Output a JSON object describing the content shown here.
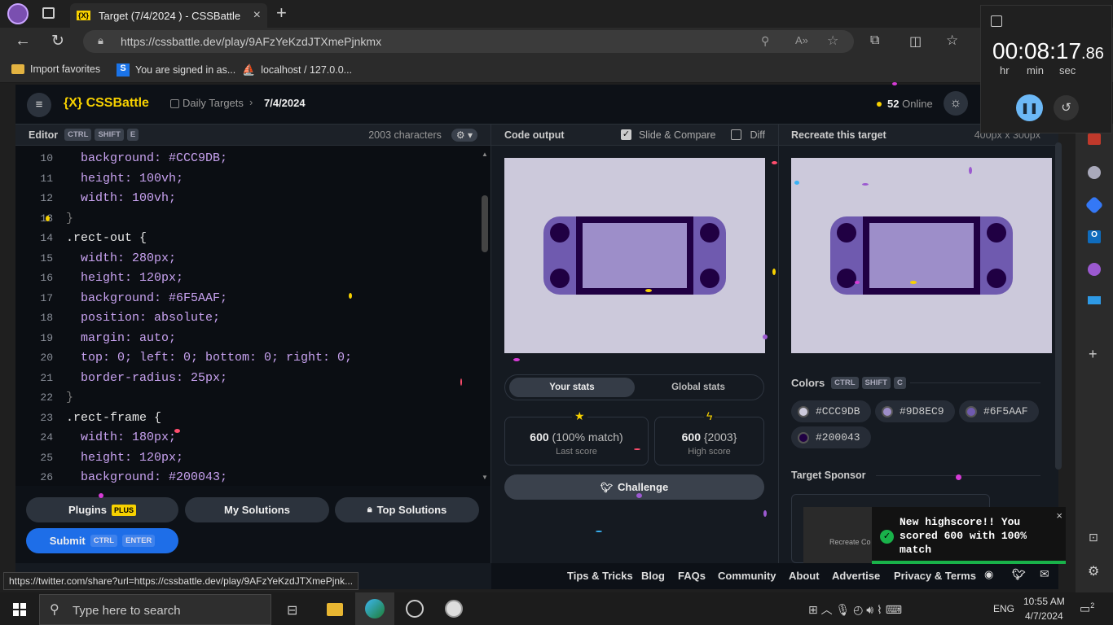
{
  "browser": {
    "tab_title": "Target (7/4/2024 ) - CSSBattle",
    "url": "https://cssbattle.dev/play/9AFzYeKzdJTXmePjnkmx",
    "favorites": [
      "Import favorites",
      "You are signed in as...",
      "localhost / 127.0.0..."
    ]
  },
  "timer": {
    "hours": "00",
    "minutes": "08",
    "seconds": "17",
    "fraction": ".86",
    "labels": [
      "hr",
      "min",
      "sec"
    ]
  },
  "site": {
    "logo": "{X} CSSBattle",
    "breadcrumb_section": "Daily Targets",
    "breadcrumb_date": "7/4/2024",
    "online_count": "52",
    "online_label": "Online"
  },
  "editor": {
    "label": "Editor",
    "keys": [
      "CTRL",
      "SHIFT",
      "E"
    ],
    "chars": "2003 characters",
    "lines": [
      {
        "n": "10",
        "t": "  background: #CCC9DB;"
      },
      {
        "n": "11",
        "t": "  height: 100vh;"
      },
      {
        "n": "12",
        "t": "  width: 100vh;"
      },
      {
        "n": "13",
        "t": "}"
      },
      {
        "n": "14",
        "t": ".rect-out {"
      },
      {
        "n": "15",
        "t": "  width: 280px;"
      },
      {
        "n": "16",
        "t": "  height: 120px;"
      },
      {
        "n": "17",
        "t": "  background: #6F5AAF;"
      },
      {
        "n": "18",
        "t": "  position: absolute;"
      },
      {
        "n": "19",
        "t": "  margin: auto;"
      },
      {
        "n": "20",
        "t": "  top: 0; left: 0; bottom: 0; right: 0;"
      },
      {
        "n": "21",
        "t": "  border-radius: 25px;"
      },
      {
        "n": "22",
        "t": "}"
      },
      {
        "n": "23",
        "t": ".rect-frame {"
      },
      {
        "n": "24",
        "t": "  width: 180px;"
      },
      {
        "n": "25",
        "t": "  height: 120px;"
      },
      {
        "n": "26",
        "t": "  background: #200043;"
      }
    ]
  },
  "buttons": {
    "plugins": "Plugins",
    "plus": "PLUS",
    "my_solutions": "My Solutions",
    "top_solutions": "Top Solutions",
    "submit": "Submit",
    "submit_keys": [
      "CTRL",
      "ENTER"
    ]
  },
  "output": {
    "label": "Code output",
    "slide_compare": "Slide & Compare",
    "diff": "Diff"
  },
  "stats": {
    "your_tab": "Your stats",
    "global_tab": "Global stats",
    "last_score": "600",
    "last_match": "(100% match)",
    "last_label": "Last score",
    "high_score": "600",
    "high_chars": "{2003}",
    "high_label": "High score",
    "challenge": "Challenge"
  },
  "target": {
    "label": "Recreate this target",
    "size": "400px x 300px",
    "colors_label": "Colors",
    "colors_keys": [
      "CTRL",
      "SHIFT",
      "C"
    ],
    "colors": [
      {
        "hex": "#CCC9DB"
      },
      {
        "hex": "#9D8EC9"
      },
      {
        "hex": "#6F5AAF"
      },
      {
        "hex": "#200043"
      }
    ],
    "sponsor_label": "Target Sponsor",
    "sponsor_text": "Recreate Co"
  },
  "toast": {
    "text": "New highscore!! You scored 600 with 100% match"
  },
  "footer": {
    "links": [
      "Tips & Tricks",
      "Blog",
      "FAQs",
      "Community",
      "About",
      "Advertise",
      "Privacy & Terms"
    ]
  },
  "status_url": "https://twitter.com/share?url=https://cssbattle.dev/play/9AFzYeKzdJTXmePjnk...",
  "taskbar": {
    "search": "Type here to search",
    "time": "10:55 AM",
    "date": "4/7/2024",
    "lang": "ENG",
    "notif": "2"
  },
  "palette": {
    "bg": "#CCC9DB",
    "light": "#9D8EC9",
    "mid": "#6F5AAF",
    "dark": "#200043"
  }
}
